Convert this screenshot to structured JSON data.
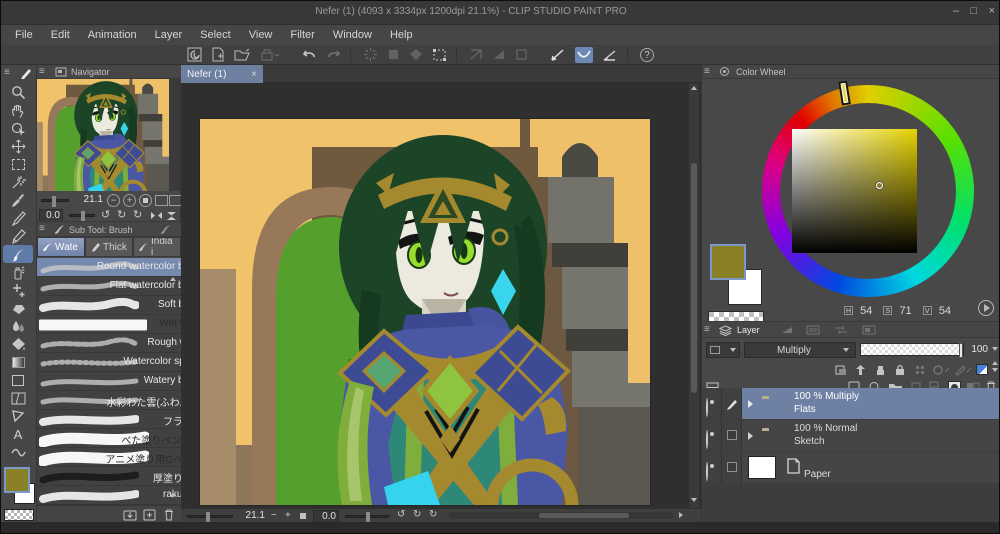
{
  "window": {
    "title": "Nefer (1) (4093 x 3334px 1200dpi 21.1%) - CLIP STUDIO PAINT PRO",
    "minimize": "–",
    "maximize": "□",
    "close": "×"
  },
  "menu": {
    "items": [
      {
        "label": "File"
      },
      {
        "label": "Edit"
      },
      {
        "label": "Animation"
      },
      {
        "label": "Layer"
      },
      {
        "label": "Select"
      },
      {
        "label": "View"
      },
      {
        "label": "Filter"
      },
      {
        "label": "Window"
      },
      {
        "label": "Help"
      }
    ]
  },
  "command_bar": {
    "icons": [
      "clip-studio-logo",
      "new-canvas",
      "open-file",
      "save",
      "undo",
      "redo",
      "processing",
      "fill-object",
      "shape",
      "transform",
      "snap-off-1",
      "snap-off-2",
      "snap-off-3",
      "snap-to-ruler",
      "snap-to-special-ruler",
      "snap-to-grid",
      "help"
    ],
    "help_glyph": "?"
  },
  "tool_strip": {
    "tools": [
      "zoom",
      "hand",
      "operation",
      "move-layer",
      "selection",
      "auto-select",
      "eyedropper",
      "pen",
      "pencil",
      "brush",
      "airbrush",
      "decoration",
      "eraser",
      "blend",
      "fill",
      "gradient",
      "figure",
      "frame-border",
      "correct-line",
      "text",
      "liquify"
    ],
    "selected_tool": "brush",
    "text_tool_glyph": "A",
    "primary_color": "#8a8028",
    "secondary_color": "#ffffff"
  },
  "navigator": {
    "title": "Navigator",
    "zoom": "21.1",
    "rotation": "0.0",
    "zoom_out": "−",
    "zoom_in": "+"
  },
  "subtool": {
    "title": "Sub Tool: Brush",
    "tabs": [
      {
        "label": "Wate"
      },
      {
        "label": "Thick"
      },
      {
        "label": "India i"
      }
    ],
    "brushes": [
      {
        "label": "Round watercolor brush"
      },
      {
        "label": "Flat watercolor brush"
      },
      {
        "label": "Soft bleed"
      },
      {
        "label": "Wet wash"
      },
      {
        "label": "Rough wash"
      },
      {
        "label": "Watercolor splash"
      },
      {
        "label": "Watery brush"
      },
      {
        "label": "水彩わた雲(ふわふわ)"
      },
      {
        "label": "フラット"
      },
      {
        "label": "べた塗りペン_QM"
      },
      {
        "label": "アニメ塗り用Gペン改"
      },
      {
        "label": "厚塗りペン"
      },
      {
        "label": "rakuPEN"
      },
      {
        "label": ""
      }
    ],
    "selected_brush": "Round watercolor brush"
  },
  "canvas": {
    "tab": "Nefer (1)",
    "close": "×",
    "zoom": "21.1",
    "rotation": "0.0",
    "zoom_out": "−",
    "zoom_in": "+"
  },
  "color_wheel": {
    "title": "Color Wheel",
    "h_label": "H",
    "h": "54",
    "s_label": "S",
    "s": "71",
    "v_label": "V",
    "v": "54",
    "current_color": "#8a8028",
    "sub_color": "#ffffff"
  },
  "layers_panel": {
    "title": "Layer",
    "blend_mode": "Multiply",
    "opacity": "100",
    "layers": [
      {
        "opacity_text": "100 %",
        "mode": "Multiply",
        "name": "Flats",
        "selected": true
      },
      {
        "opacity_text": "100 %",
        "mode": "Normal",
        "name": "Sketch",
        "selected": false
      },
      {
        "opacity_text": "",
        "mode": "",
        "name": "Paper",
        "selected": false
      }
    ]
  },
  "colors": {
    "selection_accent": "#7689ae",
    "panel_bg": "#484848",
    "canvas_bg": "#2f2f2f",
    "titlebar_bg": "#383838"
  }
}
